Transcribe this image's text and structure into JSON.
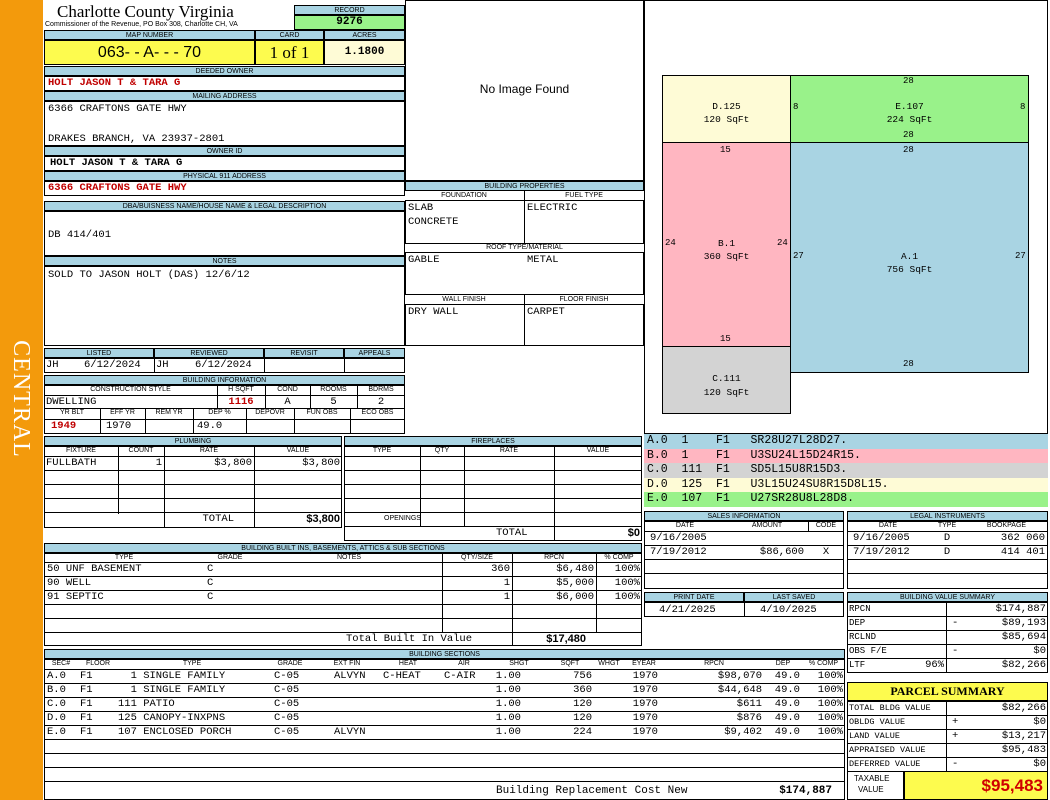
{
  "side_label": "CENTRAL",
  "header": {
    "county": "Charlotte County Virginia",
    "commissioner": "Commissioner of the Revenue, PO Box 308, Charlotte CH, VA",
    "record_label": "RECORD",
    "record": "9276",
    "map_label": "MAP NUMBER",
    "map": "063- - A- - - 70",
    "card_label": "CARD",
    "card": "1 of 1",
    "acres_label": "ACRES",
    "acres": "1.1800"
  },
  "owner": {
    "deeded_label": "DEEDED OWNER",
    "deeded": "HOLT JASON T & TARA G",
    "mailing_label": "MAILING ADDRESS",
    "mail1": "6366 CRAFTONS GATE HWY",
    "mail2": "DRAKES BRANCH, VA 23937-2801",
    "owner_id_label": "OWNER ID",
    "owner_id": "HOLT JASON T & TARA G",
    "phys_label": "PHYSICAL 911 ADDRESS",
    "phys": "6366 CRAFTONS GATE HWY"
  },
  "dba": {
    "label": "DBA/BUISNESS NAME/HOUSE NAME & LEGAL DESCRIPTION",
    "value": "DB 414/401"
  },
  "notes": {
    "label": "NOTES",
    "value": "SOLD TO JASON HOLT (DAS) 12/6/12"
  },
  "image": {
    "text": "No Image Found"
  },
  "building_props": {
    "label": "BUILDING PROPERTIES",
    "foundation_label": "FOUNDATION",
    "foundation1": "SLAB",
    "foundation2": "CONCRETE",
    "fuel_label": "FUEL TYPE",
    "fuel": "ELECTRIC",
    "roof_label": "ROOF TYPE/MATERIAL",
    "roof_type": "GABLE",
    "roof_mat": "METAL",
    "wall_label": "WALL FINISH",
    "wall": "DRY WALL",
    "floor_label": "FLOOR FINISH",
    "floor": "CARPET"
  },
  "listed": {
    "listed_label": "LISTED",
    "listed_by": "JH",
    "listed_date": "6/12/2024",
    "reviewed_label": "REVIEWED",
    "reviewed_by": "JH",
    "reviewed_date": "6/12/2024",
    "revisit_label": "REVISIT",
    "appeals_label": "APPEALS"
  },
  "building_info": {
    "label": "BUILDING INFORMATION",
    "style_label": "CONSTRUCTION STYLE",
    "style": "DWELLING",
    "hsqft_label": "H SQFT",
    "hsqft": "1116",
    "cond_label": "COND",
    "cond": "A",
    "rooms_label": "ROOMS",
    "rooms": "5",
    "bdrms_label": "BDRMS",
    "bdrms": "2",
    "yrblt_label": "YR BLT",
    "yrblt": "1949",
    "effyr_label": "EFF YR",
    "effyr": "1970",
    "remyr_label": "REM YR",
    "dep_label": "DEP %",
    "dep": "49.0",
    "depovr_label": "DEPOVR",
    "funobs_label": "FUN OBS",
    "ecoobs_label": "ECO OBS"
  },
  "plumbing": {
    "label": "PLUMBING",
    "headers": [
      "FIXTURE",
      "COUNT",
      "RATE",
      "VALUE"
    ],
    "rows": [
      {
        "fixture": "FULLBATH",
        "count": "1",
        "rate": "$3,800",
        "value": "$3,800"
      }
    ],
    "total_label": "TOTAL",
    "total": "$3,800"
  },
  "fireplaces": {
    "label": "FIREPLACES",
    "headers": [
      "TYPE",
      "QTY",
      "RATE",
      "VALUE"
    ],
    "openings_label": "OPENINGS",
    "total_label": "TOTAL",
    "total": "$0"
  },
  "sketch": {
    "areas": [
      {
        "id": "D.125",
        "sqft": "120 SqFt",
        "color": "#fefbd6"
      },
      {
        "id": "E.107",
        "sqft": "224 SqFt",
        "color": "#99f28a"
      },
      {
        "id": "B.1",
        "sqft": "360 SqFt",
        "color": "#ffb6c1"
      },
      {
        "id": "A.1",
        "sqft": "756 SqFt",
        "color": "#a9d4e3"
      },
      {
        "id": "C.111",
        "sqft": "120 SqFt",
        "color": "#d3d3d3"
      }
    ],
    "dims": [
      "28",
      "8",
      "8",
      "28",
      "15",
      "28",
      "24",
      "24",
      "27",
      "27",
      "15",
      "28"
    ]
  },
  "vectors": [
    {
      "text": "A.0  1    F1   SR28U27L28D27.",
      "color": "#a9d4e3"
    },
    {
      "text": "B.0  1    F1   U3SU24L15D24R15.",
      "color": "#ffb6c1"
    },
    {
      "text": "C.0  111  F1   SD5L15U8R15D3.",
      "color": "#d3d3d3"
    },
    {
      "text": "D.0  125  F1   U3L15U24SU8R15D8L15.",
      "color": "#fefbd6"
    },
    {
      "text": "E.0  107  F1   U27SR28U8L28D8.",
      "color": "#99f28a"
    }
  ],
  "sales": {
    "label": "SALES INFORMATION",
    "headers": [
      "DATE",
      "AMOUNT",
      "CODE"
    ],
    "rows": [
      {
        "date": "9/16/2005",
        "amount": "",
        "code": ""
      },
      {
        "date": "7/19/2012",
        "amount": "$86,600",
        "code": "X"
      }
    ]
  },
  "legal": {
    "label": "LEGAL INSTRUMENTS",
    "headers": [
      "DATE",
      "TYPE",
      "BOOKPAGE"
    ],
    "rows": [
      {
        "date": "9/16/2005",
        "type": "D",
        "book": "362 060"
      },
      {
        "date": "7/19/2012",
        "type": "D",
        "book": "414 401"
      }
    ]
  },
  "dates": {
    "print_label": "PRINT DATE",
    "print": "4/21/2025",
    "saved_label": "LAST SAVED",
    "saved": "4/10/2025"
  },
  "built_ins": {
    "label": "BUILDING BUILT INS, BASEMENTS, ATTICS & SUB SECTIONS",
    "headers": [
      "TYPE",
      "GRADE",
      "NOTES",
      "QTY/SIZE",
      "RPCN",
      "% COMP"
    ],
    "rows": [
      {
        "type": "50 UNF BASEMENT",
        "grade": "C",
        "notes": "",
        "qty": "360",
        "rpcn": "$6,480",
        "comp": "100%"
      },
      {
        "type": "90 WELL",
        "grade": "C",
        "notes": "",
        "qty": "1",
        "rpcn": "$5,000",
        "comp": "100%"
      },
      {
        "type": "91 SEPTIC",
        "grade": "C",
        "notes": "",
        "qty": "1",
        "rpcn": "$6,000",
        "comp": "100%"
      }
    ],
    "total_label": "Total Built In Value",
    "total": "$17,480"
  },
  "sections": {
    "label": "BUILDING SECTIONS",
    "headers": [
      "SEC#",
      "FLOOR",
      "TYPE",
      "GRADE",
      "EXT FIN",
      "HEAT",
      "AIR",
      "SHGT",
      "SQFT",
      "WHGT",
      "EYEAR",
      "RPCN",
      "DEP",
      "% COMP"
    ],
    "rows": [
      {
        "sec": "A.0",
        "floor": "F1",
        "type": "1 SINGLE FAMILY",
        "grade": "C-05",
        "ext": "ALVYN",
        "heat": "C-HEAT",
        "air": "C-AIR",
        "shgt": "1.00",
        "sqft": "756",
        "whgt": "",
        "eyear": "1970",
        "rpcn": "$98,070",
        "dep": "49.0",
        "comp": "100%"
      },
      {
        "sec": "B.0",
        "floor": "F1",
        "type": "1 SINGLE FAMILY",
        "grade": "C-05",
        "ext": "",
        "heat": "",
        "air": "",
        "shgt": "1.00",
        "sqft": "360",
        "whgt": "",
        "eyear": "1970",
        "rpcn": "$44,648",
        "dep": "49.0",
        "comp": "100%"
      },
      {
        "sec": "C.0",
        "floor": "F1",
        "type": "111 PATIO",
        "grade": "C-05",
        "ext": "",
        "heat": "",
        "air": "",
        "shgt": "1.00",
        "sqft": "120",
        "whgt": "",
        "eyear": "1970",
        "rpcn": "$611",
        "dep": "49.0",
        "comp": "100%"
      },
      {
        "sec": "D.0",
        "floor": "F1",
        "type": "125 CANOPY-INXPNS",
        "grade": "C-05",
        "ext": "",
        "heat": "",
        "air": "",
        "shgt": "1.00",
        "sqft": "120",
        "whgt": "",
        "eyear": "1970",
        "rpcn": "$876",
        "dep": "49.0",
        "comp": "100%"
      },
      {
        "sec": "E.0",
        "floor": "F1",
        "type": "107 ENCLOSED PORCH",
        "grade": "C-05",
        "ext": "ALVYN",
        "heat": "",
        "air": "",
        "shgt": "1.00",
        "sqft": "224",
        "whgt": "",
        "eyear": "1970",
        "rpcn": "$9,402",
        "dep": "49.0",
        "comp": "100%"
      }
    ],
    "rcn_label": "Building Replacement Cost New",
    "rcn": "$174,887"
  },
  "value_summary": {
    "label": "BUILDING VALUE SUMMARY",
    "rows": [
      {
        "label": "RPCN",
        "sign": "",
        "pct": "",
        "value": "$174,887"
      },
      {
        "label": "DEP",
        "sign": "-",
        "pct": "",
        "value": "$89,193"
      },
      {
        "label": "RCLND",
        "sign": "",
        "pct": "",
        "value": "$85,694"
      },
      {
        "label": "OBS F/E",
        "sign": "-",
        "pct": "",
        "value": "$0"
      },
      {
        "label": "LTF",
        "sign": "",
        "pct": "96%",
        "value": "$82,266"
      }
    ]
  },
  "parcel": {
    "label": "PARCEL SUMMARY",
    "rows": [
      {
        "label": "TOTAL BLDG VALUE",
        "sign": "",
        "value": "$82,266"
      },
      {
        "label": "OBLDG VALUE",
        "sign": "+",
        "value": "$0"
      },
      {
        "label": "LAND VALUE",
        "sign": "+",
        "value": "$13,217"
      },
      {
        "label": "APPRAISED VALUE",
        "sign": "",
        "value": "$95,483"
      },
      {
        "label": "DEFERRED VALUE",
        "sign": "-",
        "value": "$0"
      }
    ],
    "taxable_label1": "TAXABLE",
    "taxable_label2": "VALUE",
    "taxable": "$95,483"
  }
}
